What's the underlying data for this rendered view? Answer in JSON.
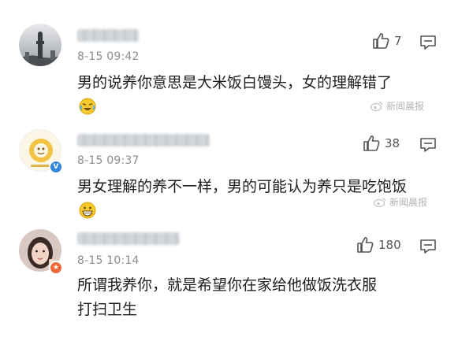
{
  "comments": [
    {
      "time": "8-15 09:42",
      "text": "男的说养你意思是大米饭白馒头，女的理解错了",
      "likes": "7",
      "like_icon": "thumbs-up-icon",
      "reply_icon": "comment-icon",
      "emoji_icon": "crying-laughing-emoji",
      "watermark": "新闻晨报"
    },
    {
      "time": "8-15 09:37",
      "text": "男女理解的养不一样，男的可能认为养只是吃饱饭",
      "likes": "38",
      "like_icon": "thumbs-up-icon",
      "reply_icon": "comment-icon",
      "emoji_icon": "grinning-emoji",
      "watermark": "新闻晨报",
      "badge": "V",
      "badge_color": "#2f86d6"
    },
    {
      "time": "8-15 10:14",
      "text": "所谓我养你，就是希望你在家给他做饭洗衣服打扫卫生",
      "likes": "180",
      "like_icon": "thumbs-up-icon",
      "reply_icon": "comment-icon",
      "badge_color": "#ee6a3b"
    }
  ]
}
